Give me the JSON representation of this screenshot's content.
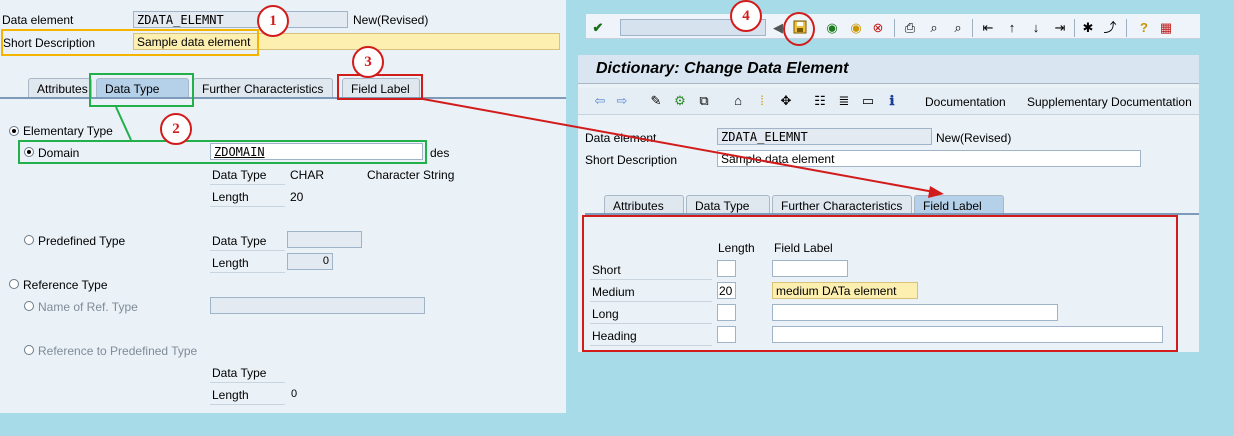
{
  "left": {
    "data_element_label": "Data element",
    "data_element_value": "ZDATA_ELEMNT",
    "data_element_status": "New(Revised)",
    "short_desc_label": "Short Description",
    "short_desc_value": "Sample data element",
    "tabs": [
      "Attributes",
      "Data Type",
      "Further Characteristics",
      "Field Label"
    ],
    "elementary_type": "Elementary Type",
    "domain_label": "Domain",
    "domain_value": "ZDOMAIN",
    "domain_desc": "des",
    "dt_label": "Data Type",
    "dt_value": "CHAR",
    "dt_text": "Character String",
    "len_label": "Length",
    "len_value": "20",
    "predefined_type": "Predefined Type",
    "pre_dt_label": "Data Type",
    "pre_len_label": "Length",
    "pre_len_value": "0",
    "reference_type": "Reference Type",
    "name_ref_type": "Name of Ref. Type",
    "ref_predefined": "Reference to Predefined Type",
    "ref_dt_label": "Data Type",
    "ref_len_label": "Length",
    "ref_len_value": "0"
  },
  "right": {
    "title": "Dictionary: Change Data Element",
    "documentation": "Documentation",
    "supplementary_documentation": "Supplementary Documentation",
    "data_element_label": "Data element",
    "data_element_value": "ZDATA_ELEMNT",
    "data_element_status": "New(Revised)",
    "short_desc_label": "Short Description",
    "short_desc_value": "Sample data element",
    "tabs": [
      "Attributes",
      "Data Type",
      "Further Characteristics",
      "Field Label"
    ],
    "length_header": "Length",
    "field_label_header": "Field Label",
    "rows": [
      {
        "label": "Short",
        "length": "",
        "value": ""
      },
      {
        "label": "Medium",
        "length": "20",
        "value": "medium DATa element"
      },
      {
        "label": "Long",
        "length": "",
        "value": ""
      },
      {
        "label": "Heading",
        "length": "",
        "value": ""
      }
    ]
  },
  "callouts": [
    "1",
    "2",
    "3",
    "4"
  ],
  "colors": {
    "background": "#a8dbe8",
    "panel": "#eaf1f7",
    "annotation_red": "#d21c1c",
    "annotation_green": "#22b04b",
    "annotation_orange": "#f5b400"
  },
  "icons": [
    "check-icon",
    "back-icon",
    "save-icon",
    "green-arrow-icon",
    "exit-icon",
    "cancel-icon",
    "print-icon",
    "find-icon",
    "find-next-icon",
    "first-page-icon",
    "prev-page-icon",
    "next-page-icon",
    "last-page-icon",
    "new-session-icon",
    "shortcut-icon",
    "help-icon",
    "layout-icon"
  ]
}
